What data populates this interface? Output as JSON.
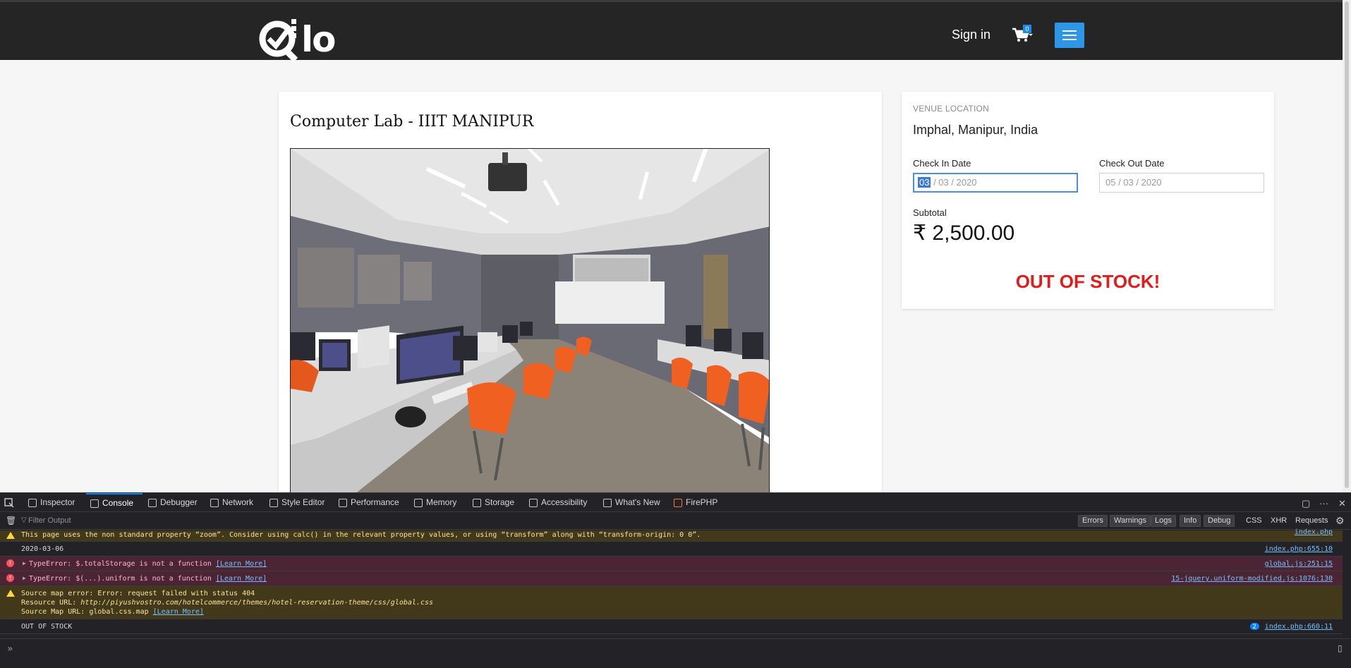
{
  "header": {
    "logo_text": "lo",
    "signin_label": "Sign in",
    "cart_count": "0"
  },
  "room": {
    "title": "Computer Lab - IIIT MANIPUR"
  },
  "booking": {
    "venue_label": "VENUE LOCATION",
    "venue_value": "Imphal, Manipur, India",
    "checkin_label": "Check In Date",
    "checkin_day": "03",
    "checkin_rest": " / 03 / 2020",
    "checkout_label": "Check Out Date",
    "checkout_value": "05 / 03 / 2020",
    "subtotal_label": "Subtotal",
    "subtotal_value": "₹ 2,500.00",
    "stock_status": "OUT OF STOCK!"
  },
  "devtools": {
    "tabs": [
      {
        "label": "Inspector",
        "icon": "inspector-icon"
      },
      {
        "label": "Console",
        "icon": "console-icon"
      },
      {
        "label": "Debugger",
        "icon": "debugger-icon"
      },
      {
        "label": "Network",
        "icon": "network-icon"
      },
      {
        "label": "Style Editor",
        "icon": "style-editor-icon"
      },
      {
        "label": "Performance",
        "icon": "performance-icon"
      },
      {
        "label": "Memory",
        "icon": "memory-icon"
      },
      {
        "label": "Storage",
        "icon": "storage-icon"
      },
      {
        "label": "Accessibility",
        "icon": "accessibility-icon"
      },
      {
        "label": "What's New",
        "icon": "whats-new-icon"
      },
      {
        "label": "FirePHP",
        "icon": "firephp-icon"
      }
    ],
    "filter_placeholder": "Filter Output",
    "filters": [
      "Errors",
      "Warnings",
      "Logs",
      "Info",
      "Debug"
    ],
    "filters_plain": [
      "CSS",
      "XHR",
      "Requests"
    ],
    "messages": [
      {
        "type": "warn",
        "text": "This page uses the non standard property “zoom”. Consider using calc() in the relevant property values, or using “transform” along with “transform-origin: 0 0”.",
        "source": "index.php"
      },
      {
        "type": "log",
        "text": "2020-03-06",
        "source": "index.php:655:10"
      },
      {
        "type": "err",
        "text": "TypeError: $.totalStorage is not a function ",
        "learn": "[Learn More]",
        "source": "global.js:251:15"
      },
      {
        "type": "err",
        "text": "TypeError: $(...).uniform is not a function ",
        "learn": "[Learn More]",
        "source": "15-jquery.uniform-modified.js:1076:130"
      },
      {
        "type": "warn",
        "text": "Source map error: Error: request failed with status 404",
        "line2_label": "Resource URL: ",
        "line2_url": "http://piyushvostro.com/hotelcommerce/themes/hotel-reservation-theme/css/global.css",
        "line3": "Source Map URL: global.css.map ",
        "learn": "[Learn More]"
      },
      {
        "type": "log",
        "text": "OUT OF STOCK",
        "count": "2",
        "source": "index.php:660:11"
      }
    ]
  },
  "colors": {
    "header_bg": "#252525",
    "menu_button": "#2d96e6",
    "out_of_stock": "#e31b1b",
    "devtools_bg": "#232327"
  }
}
